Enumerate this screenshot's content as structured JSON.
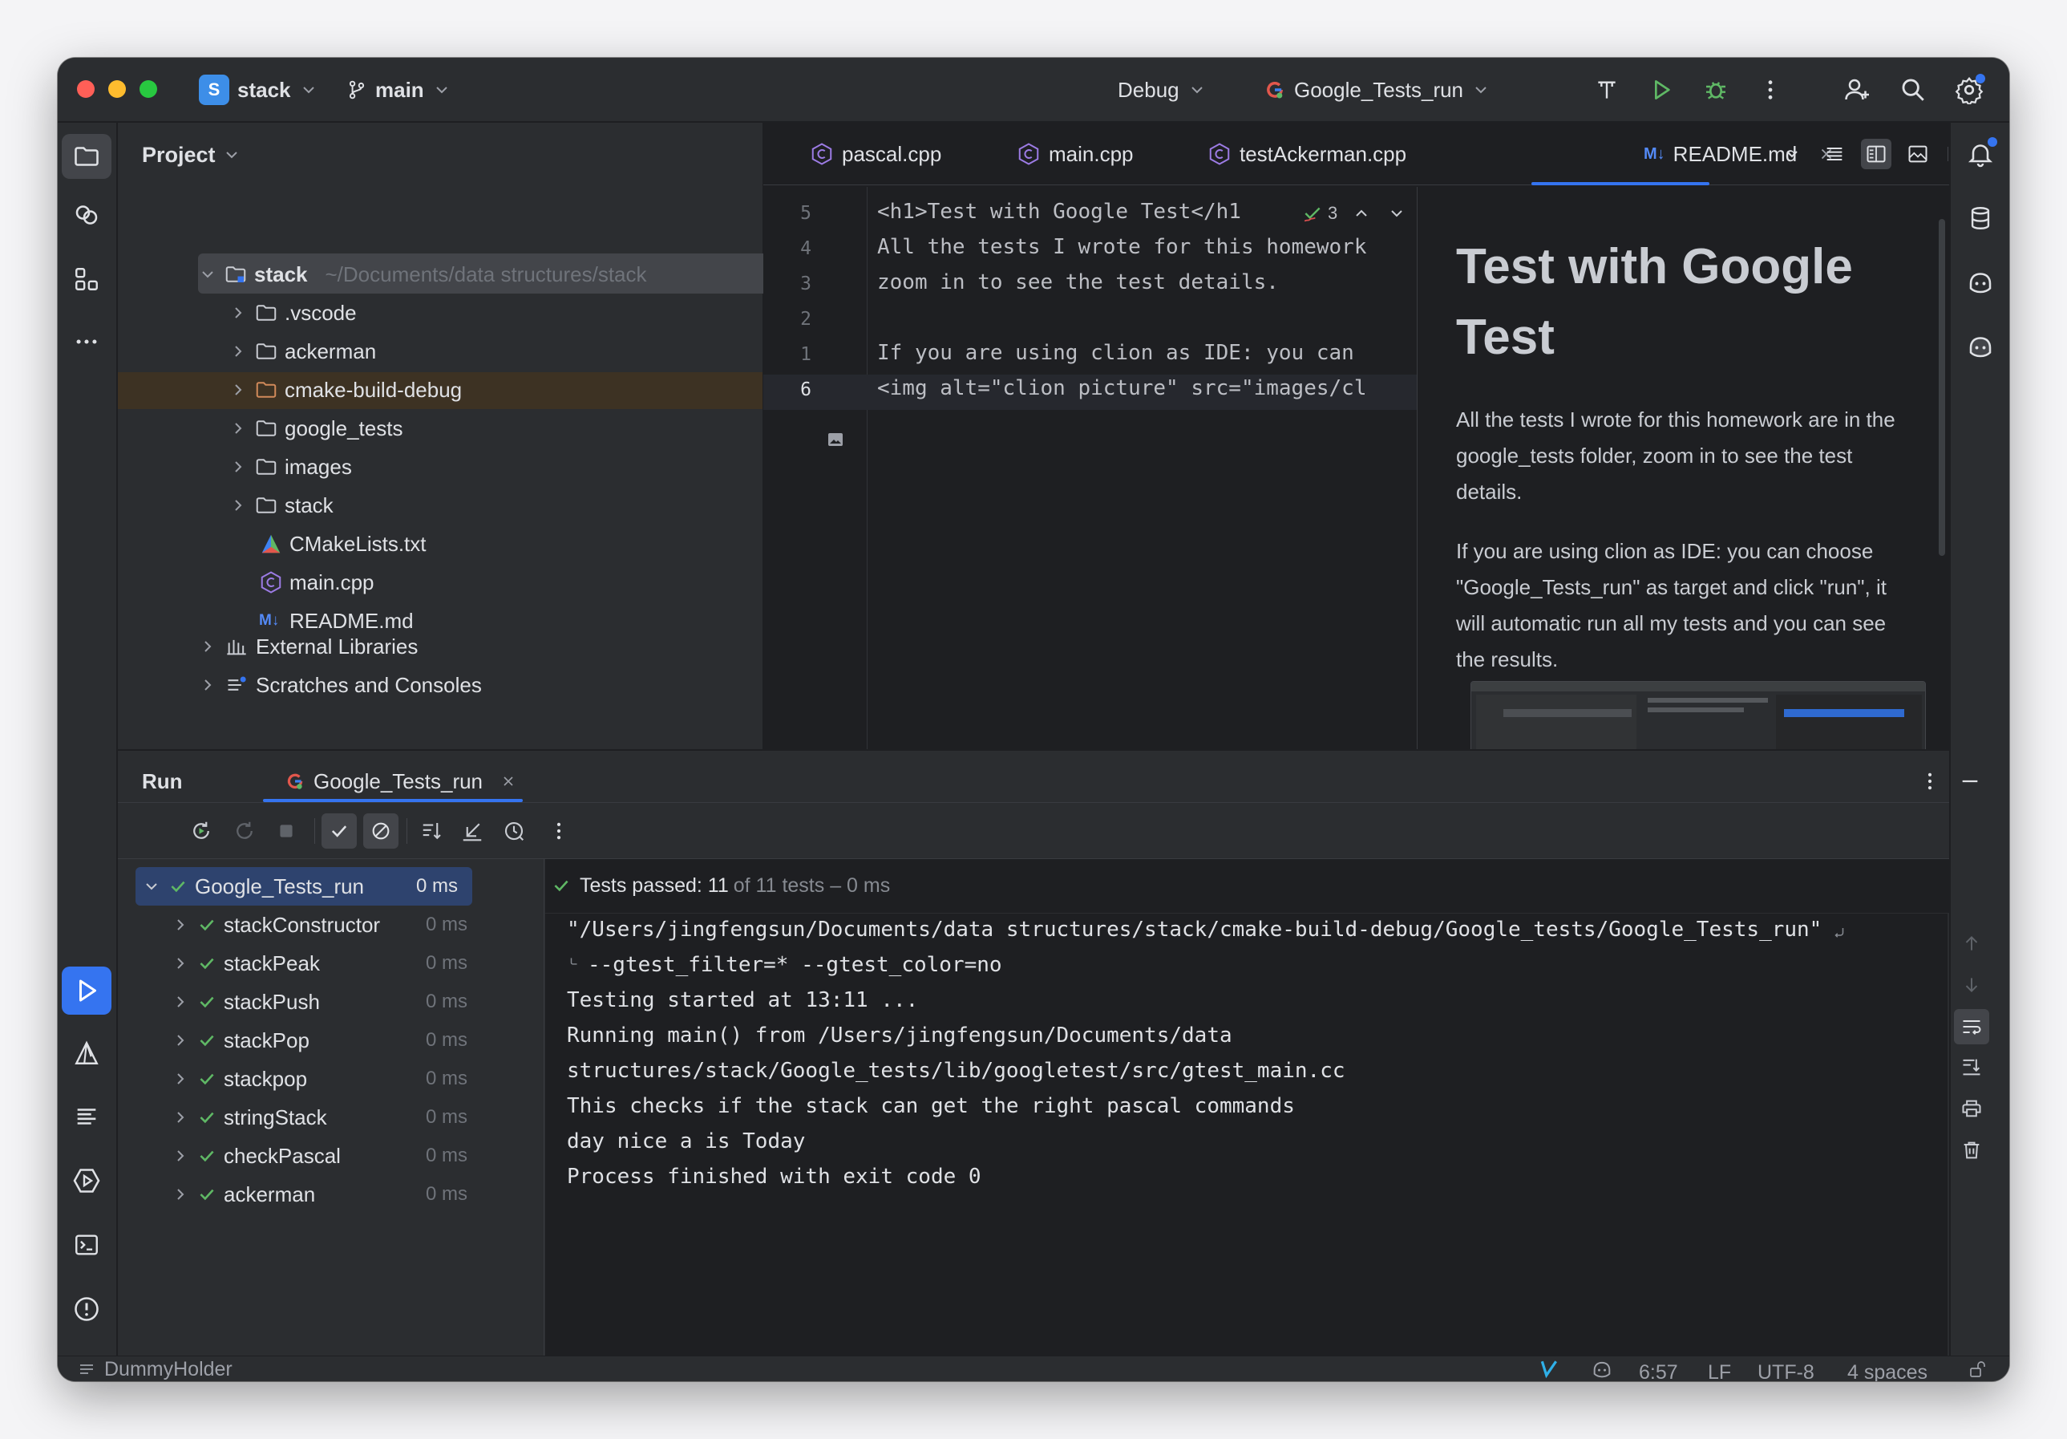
{
  "titlebar": {
    "project_initial": "S",
    "project_name": "stack",
    "branch": "main",
    "config": "Debug",
    "run_target": "Google_Tests_run"
  },
  "project_panel": {
    "title": "Project",
    "root": {
      "name": "stack",
      "path": "~/Documents/data structures/stack"
    },
    "items": [
      {
        "name": ".vscode",
        "type": "folder"
      },
      {
        "name": "ackerman",
        "type": "folder"
      },
      {
        "name": "cmake-build-debug",
        "type": "folder"
      },
      {
        "name": "google_tests",
        "type": "folder"
      },
      {
        "name": "images",
        "type": "folder"
      },
      {
        "name": "stack",
        "type": "folder"
      },
      {
        "name": "CMakeLists.txt",
        "type": "cmake"
      },
      {
        "name": "main.cpp",
        "type": "cpp"
      },
      {
        "name": "README.md",
        "type": "md"
      }
    ],
    "external": "External Libraries",
    "scratches": "Scratches and Consoles"
  },
  "editor": {
    "tabs": [
      "pascal.cpp",
      "main.cpp",
      "testAckerman.cpp",
      "README.md"
    ],
    "md_badge": "M↓",
    "active_tab": "README.md",
    "inspection_count": "3",
    "lines": [
      {
        "num": "5",
        "text": "<h1>Test with Google Test</h1"
      },
      {
        "num": "4",
        "text": "All the tests I wrote for this homework"
      },
      {
        "num": "3",
        "text": "zoom in to see the test details."
      },
      {
        "num": "2",
        "text": ""
      },
      {
        "num": "1",
        "text": "If you are using clion as IDE: you can"
      },
      {
        "num": "6",
        "text": "<img alt=\"clion picture\" src=\"images/cl"
      }
    ],
    "preview": {
      "heading_line1": "Test with Google",
      "heading_line2": "Test",
      "para1": [
        "All the tests I wrote for this homework are in the",
        "google_tests folder, zoom in to see the test",
        "details."
      ],
      "para2": [
        "If you are using clion as IDE: you can choose",
        "\"Google_Tests_run\" as target and click \"run\", it",
        "will automatic run all my tests and you can see",
        "the results."
      ]
    }
  },
  "run_panel": {
    "title": "Run",
    "tab": "Google_Tests_run",
    "summary_bold": "Tests passed: 11",
    "summary_rest": " of 11 tests – 0 ms",
    "root_test": {
      "name": "Google_Tests_run",
      "time": "0 ms"
    },
    "tests": [
      {
        "name": "stackConstructor",
        "time": "0 ms"
      },
      {
        "name": "stackPeak",
        "time": "0 ms"
      },
      {
        "name": "stackPush",
        "time": "0 ms"
      },
      {
        "name": "stackPop",
        "time": "0 ms"
      },
      {
        "name": "stackpop",
        "time": "0 ms"
      },
      {
        "name": "stringStack",
        "time": "0 ms"
      },
      {
        "name": "checkPascal",
        "time": "0 ms"
      },
      {
        "name": "ackerman",
        "time": "0 ms"
      }
    ],
    "output": [
      "\"/Users/jingfengsun/Documents/data structures/stack/cmake-build-debug/Google_tests/Google_Tests_run\"",
      "--gtest_filter=* --gtest_color=no",
      "Testing started at 13:11 ...",
      "Running main() from /Users/jingfengsun/Documents/data",
      " structures/stack/Google_tests/lib/googletest/src/gtest_main.cc",
      "This checks if the stack can get the right pascal commands",
      "day nice a is Today",
      "Process finished with exit code 0"
    ]
  },
  "statusbar": {
    "left": "DummyHolder",
    "position": "6:57",
    "line_sep": "LF",
    "encoding": "UTF-8",
    "indent": "4 spaces"
  },
  "colors": {
    "accent": "#3574f0",
    "green": "#5fb865",
    "bg": "#1e1f22",
    "panel": "#2b2d30"
  }
}
